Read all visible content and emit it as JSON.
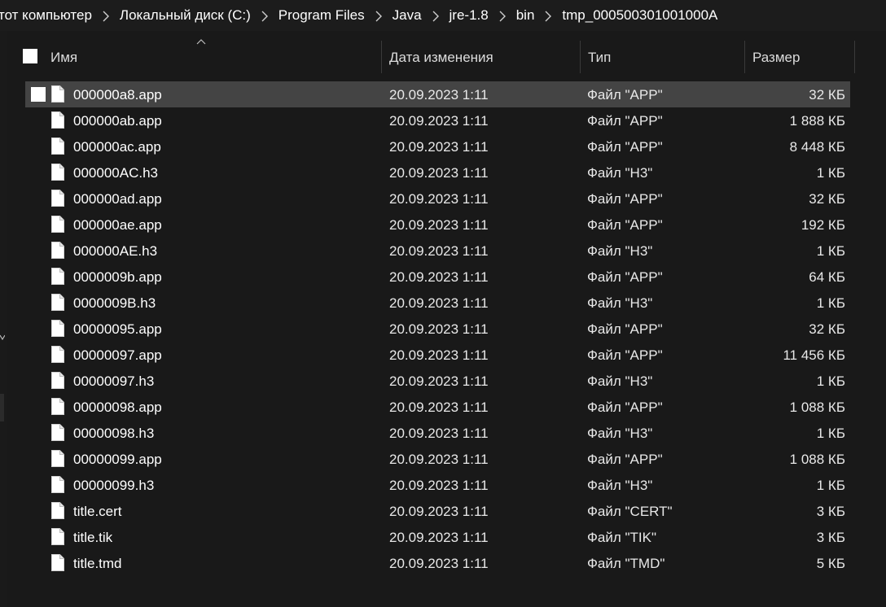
{
  "breadcrumb": {
    "items": [
      "тот компьютер",
      "Локальный диск (C:)",
      "Program Files",
      "Java",
      "jre-1.8",
      "bin",
      "tmp_000500301001000A"
    ]
  },
  "columns": {
    "name": "Имя",
    "date": "Дата изменения",
    "type": "Тип",
    "size": "Размер"
  },
  "files": [
    {
      "name": "000000a8.app",
      "date": "20.09.2023 1:11",
      "type": "Файл \"APP\"",
      "size": "32 КБ",
      "selected": true
    },
    {
      "name": "000000ab.app",
      "date": "20.09.2023 1:11",
      "type": "Файл \"APP\"",
      "size": "1 888 КБ"
    },
    {
      "name": "000000ac.app",
      "date": "20.09.2023 1:11",
      "type": "Файл \"APP\"",
      "size": "8 448 КБ"
    },
    {
      "name": "000000AC.h3",
      "date": "20.09.2023 1:11",
      "type": "Файл \"H3\"",
      "size": "1 КБ"
    },
    {
      "name": "000000ad.app",
      "date": "20.09.2023 1:11",
      "type": "Файл \"APP\"",
      "size": "32 КБ"
    },
    {
      "name": "000000ae.app",
      "date": "20.09.2023 1:11",
      "type": "Файл \"APP\"",
      "size": "192 КБ"
    },
    {
      "name": "000000AE.h3",
      "date": "20.09.2023 1:11",
      "type": "Файл \"H3\"",
      "size": "1 КБ"
    },
    {
      "name": "0000009b.app",
      "date": "20.09.2023 1:11",
      "type": "Файл \"APP\"",
      "size": "64 КБ"
    },
    {
      "name": "0000009B.h3",
      "date": "20.09.2023 1:11",
      "type": "Файл \"H3\"",
      "size": "1 КБ"
    },
    {
      "name": "00000095.app",
      "date": "20.09.2023 1:11",
      "type": "Файл \"APP\"",
      "size": "32 КБ"
    },
    {
      "name": "00000097.app",
      "date": "20.09.2023 1:11",
      "type": "Файл \"APP\"",
      "size": "11 456 КБ"
    },
    {
      "name": "00000097.h3",
      "date": "20.09.2023 1:11",
      "type": "Файл \"H3\"",
      "size": "1 КБ"
    },
    {
      "name": "00000098.app",
      "date": "20.09.2023 1:11",
      "type": "Файл \"APP\"",
      "size": "1 088 КБ"
    },
    {
      "name": "00000098.h3",
      "date": "20.09.2023 1:11",
      "type": "Файл \"H3\"",
      "size": "1 КБ"
    },
    {
      "name": "00000099.app",
      "date": "20.09.2023 1:11",
      "type": "Файл \"APP\"",
      "size": "1 088 КБ"
    },
    {
      "name": "00000099.h3",
      "date": "20.09.2023 1:11",
      "type": "Файл \"H3\"",
      "size": "1 КБ"
    },
    {
      "name": "title.cert",
      "date": "20.09.2023 1:11",
      "type": "Файл \"CERT\"",
      "size": "3 КБ"
    },
    {
      "name": "title.tik",
      "date": "20.09.2023 1:11",
      "type": "Файл \"TIK\"",
      "size": "3 КБ"
    },
    {
      "name": "title.tmd",
      "date": "20.09.2023 1:11",
      "type": "Файл \"TMD\"",
      "size": "5 КБ"
    }
  ],
  "icons": {
    "file": "file-icon",
    "separator": "chevron-right-icon",
    "sort": "sort-ascending-icon",
    "checkbox": "checkbox-icon"
  },
  "colors": {
    "background": "#191919",
    "selected_row": "#444444",
    "text": "#ffffff"
  }
}
